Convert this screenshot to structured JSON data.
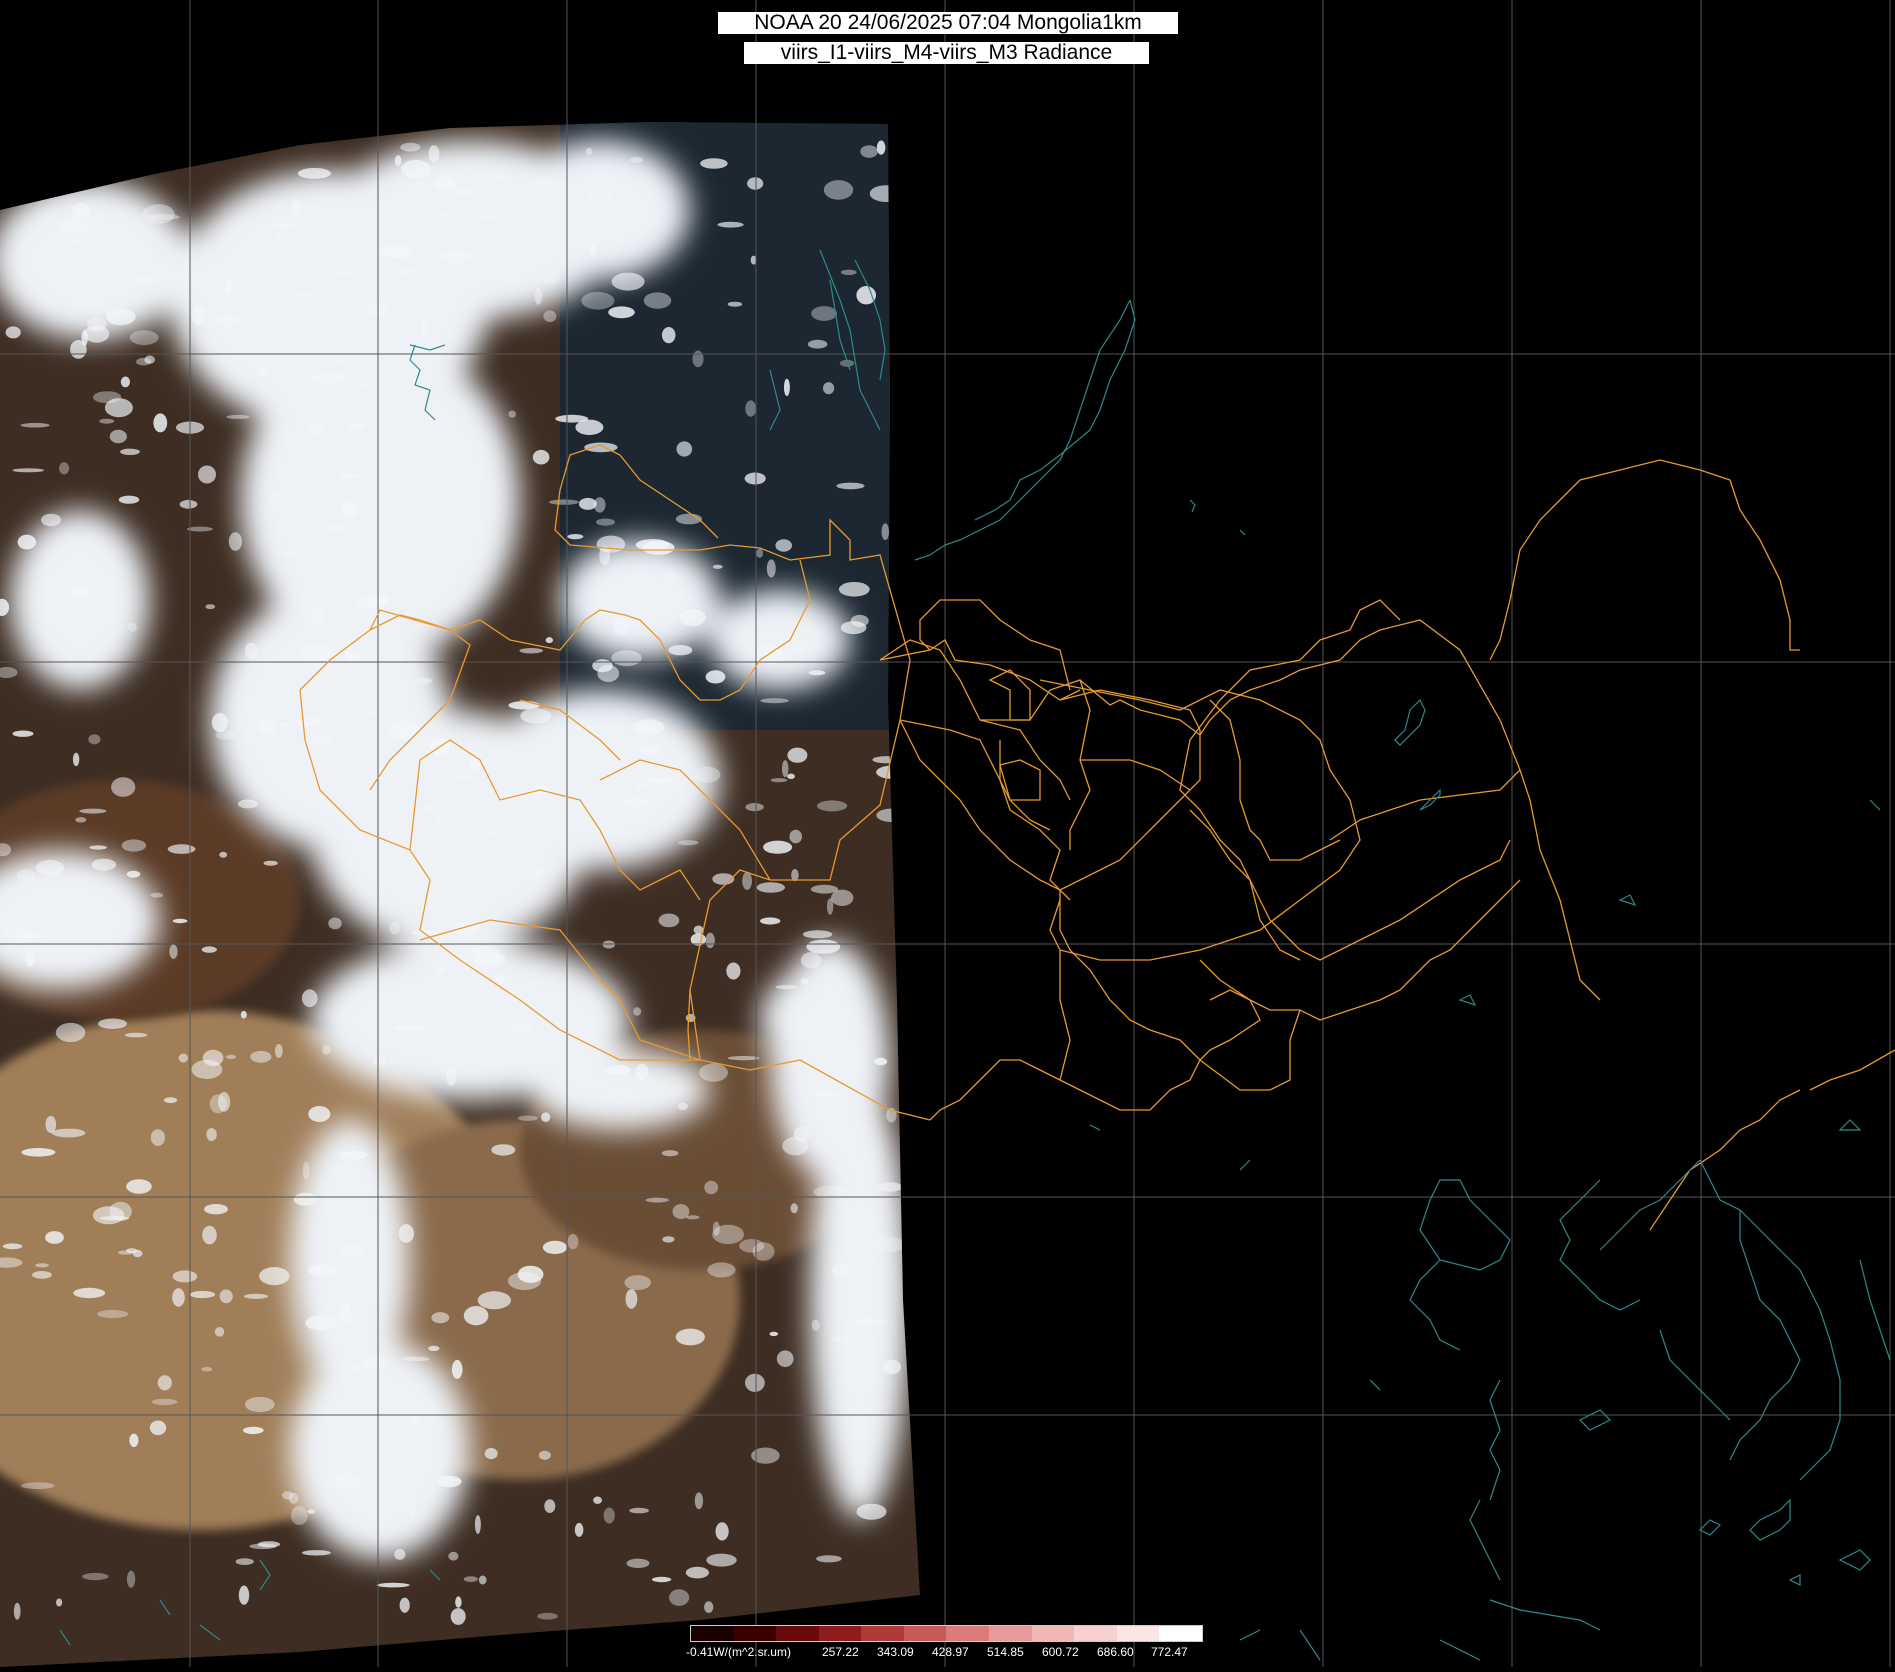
{
  "map": {
    "title_line1": "NOAA 20 24/06/2025 07:04 Mongolia1km",
    "title_line2": "viirs_I1-viirs_M4-viirs_M3 Radiance",
    "colors": {
      "background": "#000000",
      "graticule": "#555555",
      "admin_border": "#e89a30",
      "coastline": "#2f8a8a",
      "cloud": "#eef2f7",
      "desert": "#9c7a55",
      "steppe": "#5a4130",
      "forest": "#1f2d35"
    }
  },
  "legend": {
    "labels": [
      "-0.41W/(m^2.sr.um)",
      "257.22",
      "343.09",
      "428.97",
      "514.85",
      "600.72",
      "686.60",
      "772.47"
    ],
    "colors": [
      "#1a0000",
      "#3a0000",
      "#6a0a0a",
      "#8e1c1c",
      "#b03a3a",
      "#c85a5a",
      "#dc7b7b",
      "#e89a9a",
      "#f1b6b6",
      "#f7d0d0",
      "#fbe6e6",
      "#ffffff"
    ]
  }
}
